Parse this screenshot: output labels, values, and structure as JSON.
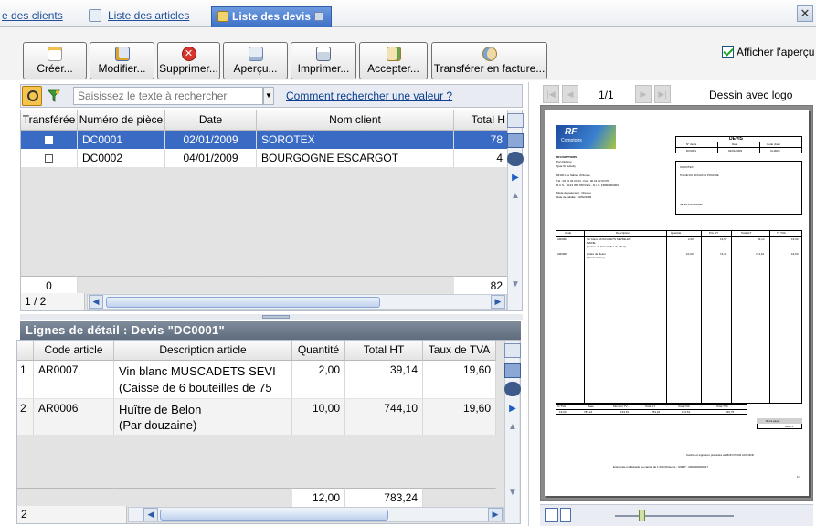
{
  "tabs": [
    {
      "label": "e des clients",
      "active": false
    },
    {
      "label": "Liste des articles",
      "active": false
    },
    {
      "label": "Liste des devis",
      "active": true
    }
  ],
  "toolbar": {
    "buttons": [
      {
        "label": "Créer...",
        "icon": "new-document-icon"
      },
      {
        "label": "Modifier...",
        "icon": "edit-icon"
      },
      {
        "label": "Supprimer...",
        "icon": "delete-icon"
      },
      {
        "label": "Aperçu...",
        "icon": "preview-icon"
      },
      {
        "label": "Imprimer...",
        "icon": "print-icon"
      },
      {
        "label": "Accepter...",
        "icon": "accept-icon"
      },
      {
        "label": "Transférer en facture...",
        "icon": "transfer-icon"
      }
    ],
    "show_preview_label": "Afficher l'aperçu",
    "show_preview_checked": true
  },
  "search": {
    "placeholder": "Saisissez le texte à rechercher",
    "help_link": "Comment rechercher une valeur ?"
  },
  "quotes": {
    "columns": [
      "Transférée",
      "Numéro de pièce",
      "Date",
      "Nom client",
      "Total H"
    ],
    "rows": [
      {
        "transferred": false,
        "number": "DC0001",
        "date": "02/01/2009",
        "client": "SOROTEX",
        "total": "78",
        "selected": true
      },
      {
        "transferred": false,
        "number": "DC0002",
        "date": "04/01/2009",
        "client": "BOURGOGNE ESCARGOT",
        "total": "4",
        "selected": false
      }
    ],
    "footer_count": "0",
    "footer_total": "82",
    "pager": "1 / 2"
  },
  "details": {
    "title": "Lignes de détail : Devis \"DC0001\"",
    "columns": [
      "Code article",
      "Description article",
      "Quantité",
      "Total HT",
      "Taux de TVA"
    ],
    "rows": [
      {
        "n": "1",
        "code": "AR0007",
        "desc1": "Vin blanc MUSCADETS SEVI",
        "desc2": "(Caisse de 6 bouteilles de 75",
        "qty": "2,00",
        "total": "39,14",
        "vat": "19,60"
      },
      {
        "n": "2",
        "code": "AR0006",
        "desc1": "Huître de Belon",
        "desc2": "(Par douzaine)",
        "qty": "10,00",
        "total": "744,10",
        "vat": "19,60"
      }
    ],
    "footer_qty": "12,00",
    "footer_total": "783,24",
    "footer_count": "2"
  },
  "preview": {
    "page": "1/1",
    "model": "Dessin avec logo",
    "doc": {
      "logo": "RF",
      "logo_sub": "Comptoirs",
      "title": "DEVIS",
      "hdr_cols": [
        "N° devis",
        "Date",
        "Code client"
      ],
      "hdr_vals": [
        "DC0001",
        "02/01/2009",
        "CL0005"
      ],
      "company": "RFCOMPTOIRS",
      "company_l1": "Port Diderne",
      "company_l2": "Quai St Nobelly",
      "company_l3": "82100 Les Sables d'Olonne",
      "company_l4": "Tél : 00 01 02 03 04 - Fax : 00 01 02 03 05",
      "company_l5": "R.C.S. : 0123 456 789 Paris - N.I.I. : FR000000000",
      "payment": "Mode de paiement : Chèque",
      "validity": "Date de validité : 02/02/2009",
      "client_name": "SOROTEX",
      "client_addr": "5 RUE DU MOULIN A POUDRE",
      "client_city": "76150    MAROMME",
      "line_cols": [
        "Code",
        "Description",
        "Quantité",
        "Prix HT",
        "Total HT",
        "Tx TVA"
      ],
      "lines": [
        {
          "code": "AR0007",
          "d1": "Vin blanc MUSCADETS SEVRE-ET-",
          "d2": "MAINE",
          "d3": "(Caisse de 6 bouteilles de 75 cl)",
          "qty": "2,00",
          "pu": "19,57",
          "tot": "39,14",
          "tva": "19,60"
        },
        {
          "code": "AR0006",
          "d1": "Huître de Belon",
          "d2": "(Par douzaine)",
          "d3": "",
          "qty": "10,00",
          "pu": "74,41",
          "tot": "744,10",
          "tva": "19,60"
        }
      ],
      "vat_cols": [
        "% TVA",
        "Base",
        "Montant TV...",
        "Total HT",
        "Total TVA",
        "Total TTC"
      ],
      "vat_vals": [
        "19,60",
        "783,24",
        "153,51",
        "783,24",
        "153,51",
        "936,75"
      ],
      "net_label": "Net à payer",
      "net_value": "936,75",
      "approval": "Cachet et signature précédés de BON POUR ACCORD",
      "footer": "Entreprise individuelle au capital de 1 000,00 Euros - SIRET : 0000000000017",
      "page_num": "1/1"
    }
  }
}
